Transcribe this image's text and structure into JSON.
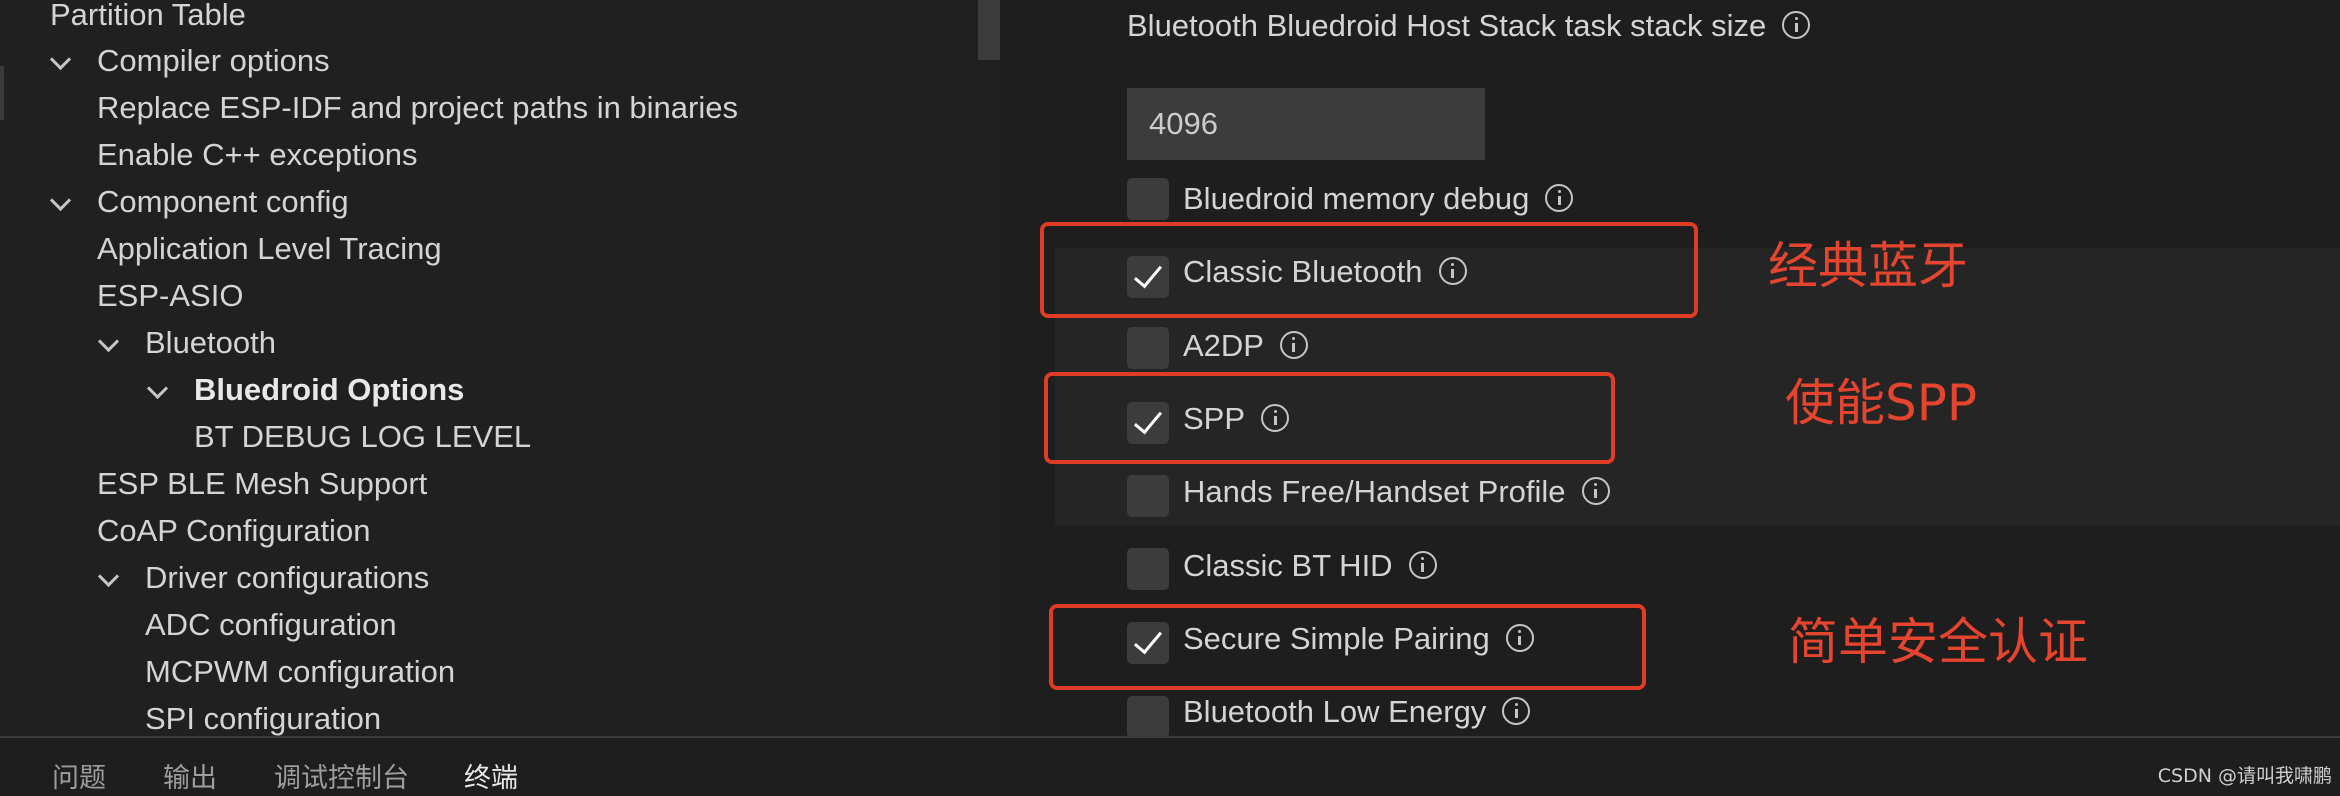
{
  "tree": {
    "items": [
      {
        "label": "Partition Table",
        "expanded": null
      },
      {
        "label": "Compiler options",
        "expanded": true
      },
      {
        "label": "Replace ESP-IDF and project paths in binaries",
        "expanded": null
      },
      {
        "label": "Enable C++ exceptions",
        "expanded": null
      },
      {
        "label": "Component config",
        "expanded": true
      },
      {
        "label": "Application Level Tracing",
        "expanded": null
      },
      {
        "label": "ESP-ASIO",
        "expanded": null
      },
      {
        "label": "Bluetooth",
        "expanded": true
      },
      {
        "label": "Bluedroid Options",
        "expanded": true,
        "selected": true
      },
      {
        "label": "BT DEBUG LOG LEVEL",
        "expanded": null
      },
      {
        "label": "ESP BLE Mesh Support",
        "expanded": null
      },
      {
        "label": "CoAP Configuration",
        "expanded": null
      },
      {
        "label": "Driver configurations",
        "expanded": true
      },
      {
        "label": "ADC configuration",
        "expanded": null
      },
      {
        "label": "MCPWM configuration",
        "expanded": null
      },
      {
        "label": "SPI configuration",
        "expanded": null
      }
    ]
  },
  "settings": {
    "stack_size_label": "Bluetooth Bluedroid Host Stack task stack size",
    "stack_size_value": "4096",
    "options": [
      {
        "label": "Bluedroid memory debug",
        "checked": false
      },
      {
        "label": "Classic Bluetooth",
        "checked": true
      },
      {
        "label": "A2DP",
        "checked": false
      },
      {
        "label": "SPP",
        "checked": true
      },
      {
        "label": "Hands Free/Handset Profile",
        "checked": false
      },
      {
        "label": "Classic BT HID",
        "checked": false
      },
      {
        "label": "Secure Simple Pairing",
        "checked": true
      },
      {
        "label": "Bluetooth Low Energy",
        "checked": false
      }
    ]
  },
  "annotations": {
    "classic_bt": "经典蓝牙",
    "spp": "使能SPP",
    "ssp": "简单安全认证",
    "color": "#e5452e"
  },
  "panel": {
    "tabs": [
      {
        "label": "问题",
        "active": false
      },
      {
        "label": "输出",
        "active": false
      },
      {
        "label": "调试控制台",
        "active": false
      },
      {
        "label": "终端",
        "active": true
      }
    ]
  },
  "watermark": "CSDN @请叫我啸鹏"
}
